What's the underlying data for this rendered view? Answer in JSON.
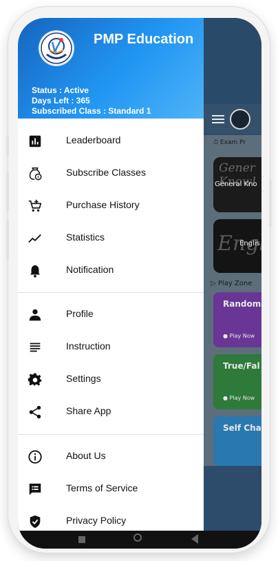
{
  "brand": {
    "name": "PMP Education",
    "logo_text": "PMP EDUCATION"
  },
  "status": {
    "status_line": "Status : Active",
    "days_line": "Days Left : 365",
    "class_line": "Subscribed Class : Standard 1"
  },
  "menu": {
    "group1": [
      {
        "label": "Leaderboard",
        "icon": "leaderboard-icon"
      },
      {
        "label": "Subscribe Classes",
        "icon": "subscribe-classes-icon"
      },
      {
        "label": "Purchase History",
        "icon": "cart-icon"
      },
      {
        "label": "Statistics",
        "icon": "trend-line-icon"
      },
      {
        "label": "Notification",
        "icon": "bell-icon"
      }
    ],
    "group2": [
      {
        "label": "Profile",
        "icon": "person-icon"
      },
      {
        "label": "Instruction",
        "icon": "lines-icon"
      },
      {
        "label": "Settings",
        "icon": "gear-icon"
      },
      {
        "label": "Share App",
        "icon": "share-icon"
      }
    ],
    "group3": [
      {
        "label": "About Us",
        "icon": "info-icon"
      },
      {
        "label": "Terms of Service",
        "icon": "message-list-icon"
      },
      {
        "label": "Privacy Policy",
        "icon": "shield-check-icon"
      }
    ]
  },
  "background_app": {
    "exam_prep": "Exam Pr",
    "card1_text": "General Kno",
    "card1_script": "Gener Knowl",
    "card2_text": "Englis",
    "card2_script": "Engl",
    "play_zone": "Play Zone",
    "play_cards": [
      {
        "title": "Random",
        "play": "Play Now",
        "color": "#7e3fb5"
      },
      {
        "title": "True/Fal",
        "play": "Play Now",
        "color": "#2e8b3e"
      },
      {
        "title": "Self Cha",
        "play": "",
        "color": "#2f86c5"
      }
    ]
  }
}
